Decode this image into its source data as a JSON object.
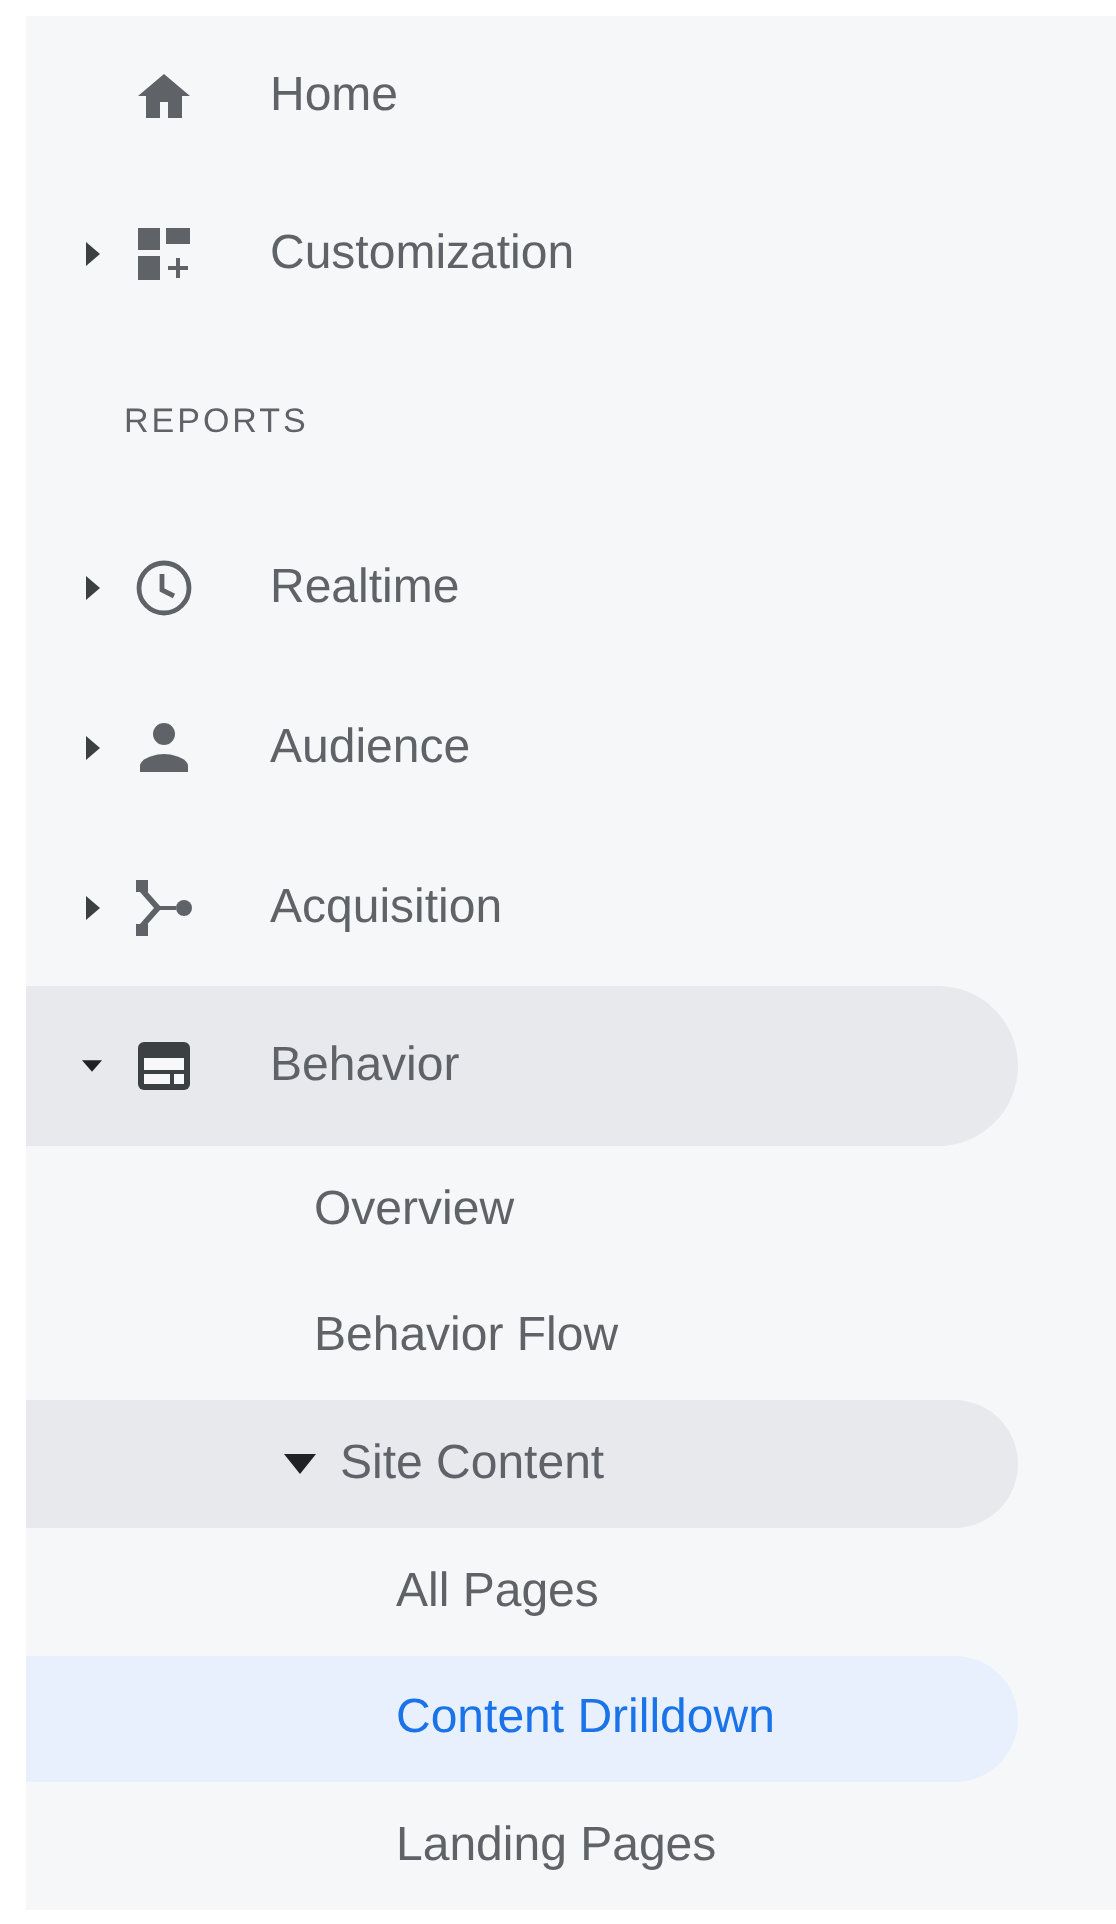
{
  "nav": [
    {
      "label": "Home",
      "kind": "home",
      "selected": false
    },
    {
      "label": "Customization",
      "kind": "customization",
      "expanded": false,
      "selected": false
    }
  ],
  "section_title": "REPORTS",
  "reports": [
    {
      "label": "Realtime",
      "kind": "realtime",
      "expanded": false,
      "selected": false
    },
    {
      "label": "Audience",
      "kind": "audience",
      "expanded": false,
      "selected": false
    },
    {
      "label": "Acquisition",
      "kind": "acquisition",
      "expanded": false,
      "selected": false
    },
    {
      "label": "Behavior",
      "kind": "behavior",
      "expanded": true,
      "selected": false,
      "children": [
        {
          "label": "Overview",
          "selected": false
        },
        {
          "label": "Behavior Flow",
          "selected": false
        },
        {
          "label": "Site Content",
          "expanded": true,
          "selected": false,
          "children": [
            {
              "label": "All Pages",
              "selected": false
            },
            {
              "label": "Content Drilldown",
              "selected": true
            },
            {
              "label": "Landing Pages",
              "selected": false
            }
          ]
        }
      ]
    }
  ]
}
